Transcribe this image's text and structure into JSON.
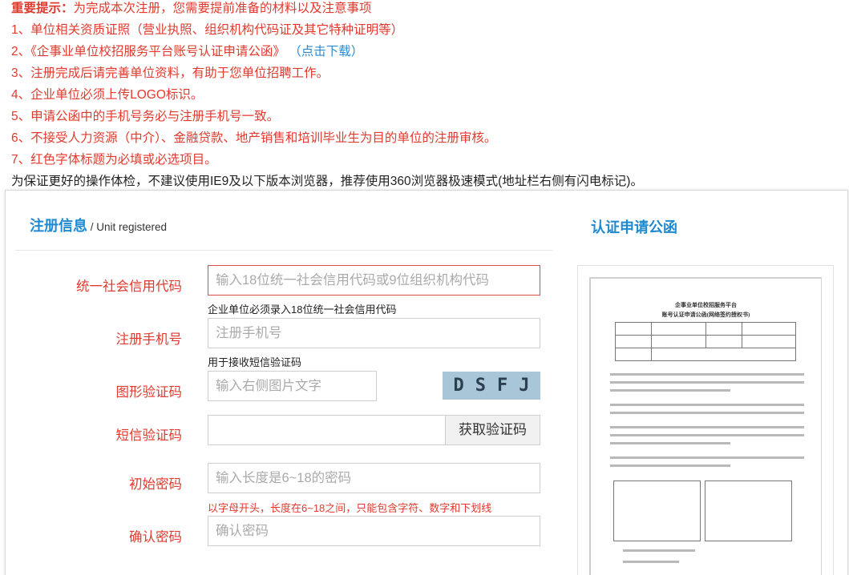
{
  "notice": {
    "heading_label": "重要提示：",
    "heading_text": "为完成本次注册，您需要提前准备的材料以及注意事项",
    "items": [
      "1、单位相关资质证照（营业执照、组织机构代码证及其它特种证明等）",
      "2、《企事业单位校招服务平台账号认证申请公函》",
      "3、注册完成后请完善单位资料，有助于您单位招聘工作。",
      "4、企业单位必须上传LOGO标识。",
      "5、申请公函中的手机号务必与注册手机号一致。",
      "6、不接受人力资源（中介）、金融贷款、地产销售和培训毕业生为目的单位的注册审核。",
      "7、红色字体标题为必填或必选项目。"
    ],
    "download_link": "（点击下载）",
    "browser_tip": "为保证更好的操作体检，不建议使用IE9及以下版本浏览器，推荐使用360浏览器极速模式(地址栏右侧有闪电标记)。"
  },
  "register": {
    "title": "注册信息",
    "title_en": " / Unit registered",
    "fields": {
      "credit_code": {
        "label": "统一社会信用代码",
        "placeholder": "输入18位统一社会信用代码或9位组织机构代码",
        "hint": "企业单位必须录入18位统一社会信用代码"
      },
      "phone": {
        "label": "注册手机号",
        "placeholder": "注册手机号",
        "hint": "用于接收短信验证码"
      },
      "captcha": {
        "label": "图形验证码",
        "placeholder": "输入右侧图片文字",
        "image_text": "DSFJ"
      },
      "sms": {
        "label": "短信验证码",
        "placeholder": "",
        "button": "获取验证码"
      },
      "password": {
        "label": "初始密码",
        "placeholder": "输入长度是6~18的密码",
        "hint": "以字母开头，长度在6~18之间，只能包含字符、数字和下划线"
      },
      "confirm": {
        "label": "确认密码",
        "placeholder": "确认密码"
      }
    }
  },
  "letter": {
    "title": "认证申请公函",
    "doc_title_1": "企事业单位校招服务平台",
    "doc_title_2": "账号认证申请公函(网络签约授权书)"
  },
  "colors": {
    "accent_blue": "#1f8ad0",
    "required_red": "#e03a2e"
  }
}
